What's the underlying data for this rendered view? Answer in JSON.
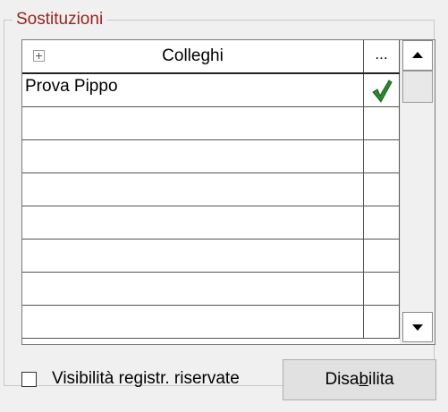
{
  "group": {
    "title": "Sostituzioni"
  },
  "grid": {
    "header": {
      "expand_icon": "plus-box-icon",
      "column_name": "Colleghi",
      "column_ellipsis": "..."
    },
    "rows": [
      {
        "name": "Prova Pippo",
        "checked": true
      },
      {
        "name": "",
        "checked": false
      },
      {
        "name": "",
        "checked": false
      },
      {
        "name": "",
        "checked": false
      },
      {
        "name": "",
        "checked": false
      },
      {
        "name": "",
        "checked": false
      },
      {
        "name": "",
        "checked": false
      },
      {
        "name": "",
        "checked": false
      }
    ],
    "check_icon": "green-checkmark-icon",
    "check_color": "#2a8a2a",
    "scrollbar": {
      "up_icon": "triangle-up-icon",
      "down_icon": "triangle-down-icon"
    }
  },
  "footer": {
    "checkbox_label": "Visibilità registr. riservate",
    "checkbox_checked": false,
    "button": {
      "label_pre": "Disa",
      "label_accel": "b",
      "label_post": "ilita"
    }
  },
  "colors": {
    "group_title": "#9a1f1f",
    "background": "#f0f0f0"
  }
}
